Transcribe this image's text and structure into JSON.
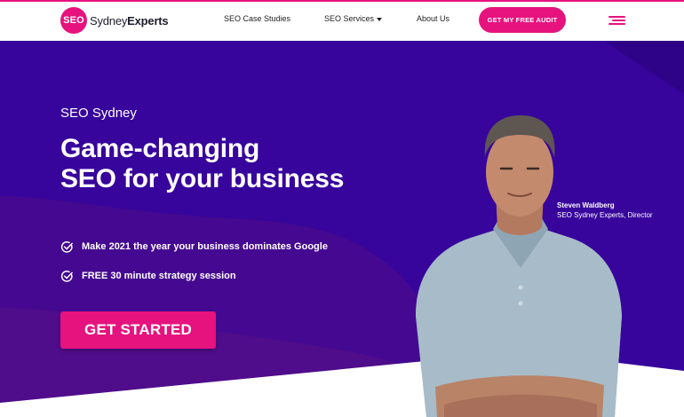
{
  "brand": {
    "badge": "SEO",
    "name_regular": "Sydney",
    "name_bold": "Experts",
    "accent_color": "#e6127e",
    "hero_color": "#37049c"
  },
  "nav": {
    "items": [
      {
        "label": "SEO Case Studies",
        "has_dropdown": false
      },
      {
        "label": "SEO Services",
        "has_dropdown": true
      },
      {
        "label": "About Us",
        "has_dropdown": false
      }
    ],
    "audit_button": "GET MY FREE AUDIT",
    "menu_icon": "hamburger-icon"
  },
  "hero": {
    "kicker": "SEO Sydney",
    "headline_line1": "Game-changing",
    "headline_line2": "SEO for your business",
    "bullets": [
      "Make 2021 the year your business dominates Google",
      "FREE 30 minute strategy session"
    ],
    "bullet_icon": "check-circle-icon",
    "cta": "GET STARTED"
  },
  "person": {
    "name": "Steven Waldberg",
    "role": "SEO Sydney Experts, Director"
  }
}
